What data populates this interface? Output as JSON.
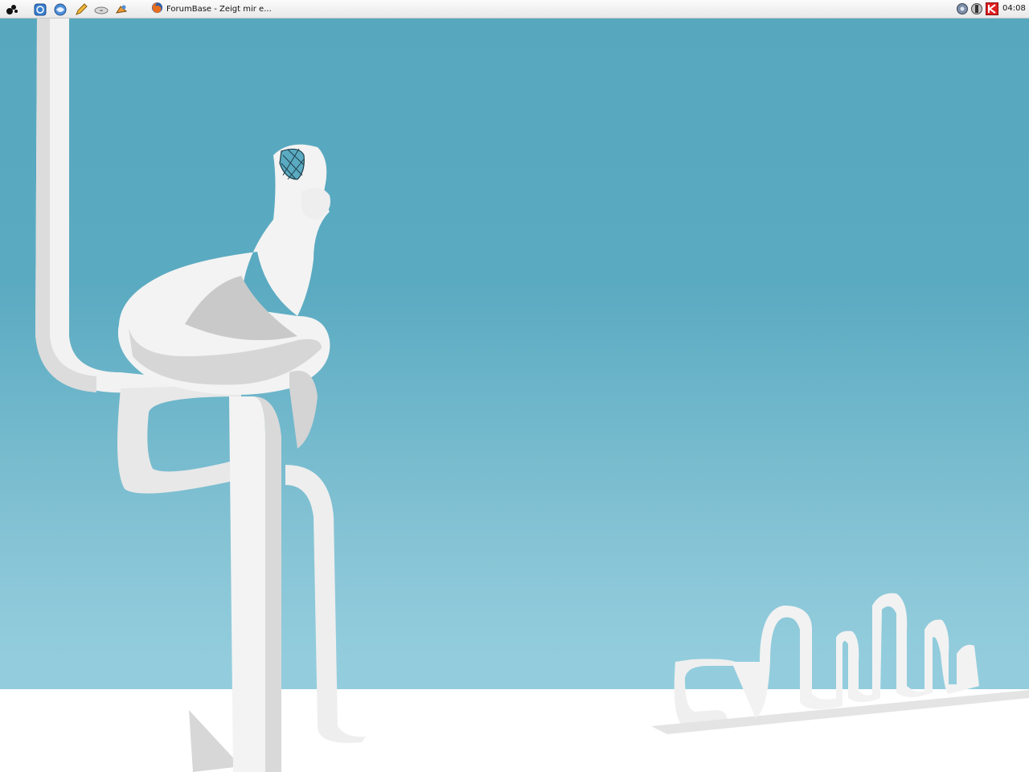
{
  "panel": {
    "launchers": [
      {
        "name": "main-menu-icon"
      },
      {
        "name": "file-manager-icon"
      },
      {
        "name": "web-browser-icon"
      },
      {
        "name": "editor-icon"
      },
      {
        "name": "disk-icon"
      },
      {
        "name": "image-tool-icon"
      }
    ],
    "taskbar": [
      {
        "label": "ForumBase - Zeigt mir e...",
        "icon": "firefox-icon"
      }
    ],
    "tray": [
      {
        "name": "volume-icon"
      },
      {
        "name": "network-icon"
      },
      {
        "name": "update-icon"
      }
    ],
    "clock": "04:08"
  },
  "colors": {
    "sky_top": "#57a8bf",
    "sky_bottom": "#93cddd",
    "sculpture": "#f2f2f2"
  }
}
